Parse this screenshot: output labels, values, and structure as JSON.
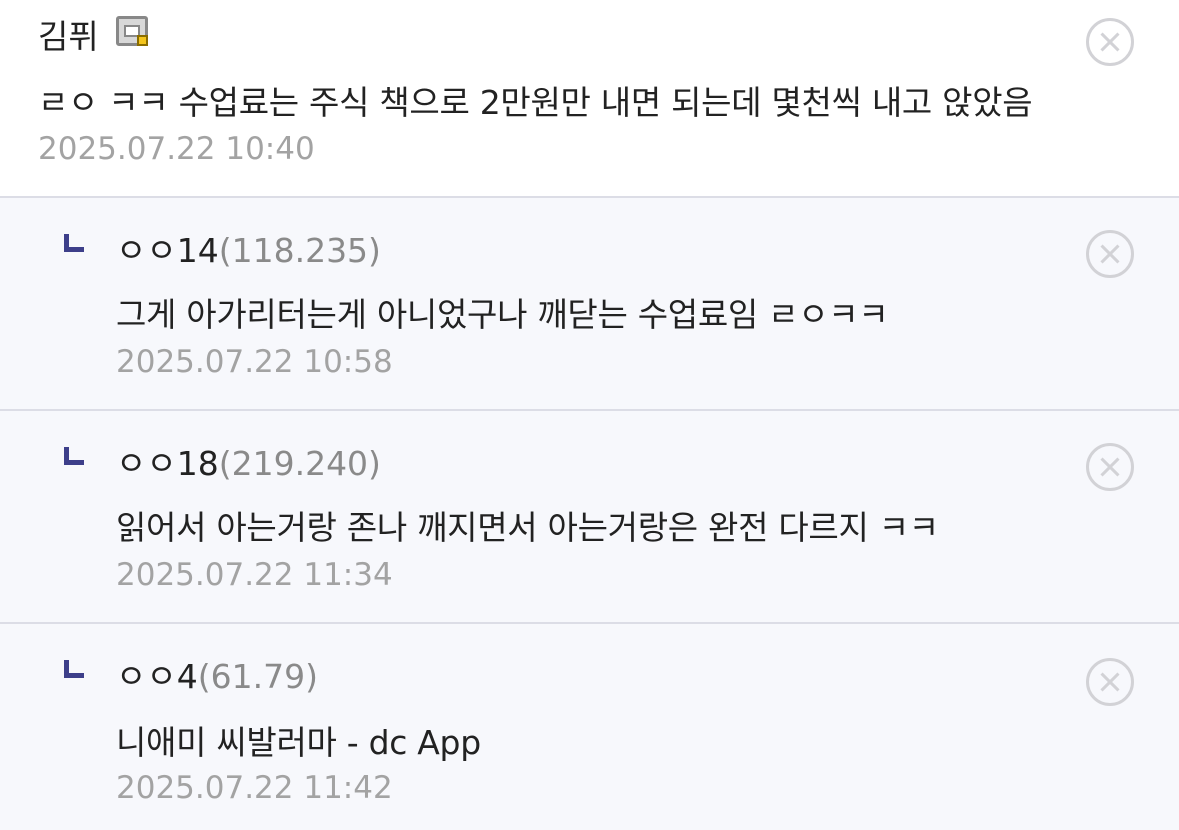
{
  "main_comment": {
    "nickname": "김퓌",
    "badge_icon": "fixed-nick-gallery-icon",
    "text": "ㄹㅇ ㅋㅋ 수업료는 주식 책으로 2만원만 내면 되는데 몇천씩 내고 앉았음",
    "date": "2025.07.22 10:40"
  },
  "replies": [
    {
      "nickname": "ㅇㅇ14",
      "ip": "(118.235)",
      "text": "그게 아가리터는게 아니었구나 깨닫는 수업료임 ㄹㅇㅋㅋ",
      "date": "2025.07.22 10:58"
    },
    {
      "nickname": "ㅇㅇ18",
      "ip": "(219.240)",
      "text": "읽어서 아는거랑 존나 깨지면서 아는거랑은 완전 다르지 ㅋㅋ",
      "date": "2025.07.22 11:34"
    },
    {
      "nickname": "ㅇㅇ4",
      "ip": "(61.79)",
      "text": "니애미 씨발러마 - dc App",
      "date": "2025.07.22 11:42"
    }
  ],
  "colors": {
    "reply_background": "#f7f8fc",
    "reply_arrow": "#3d3f8a",
    "date_text": "#a3a3a3",
    "ip_text": "#8a8a8a"
  }
}
